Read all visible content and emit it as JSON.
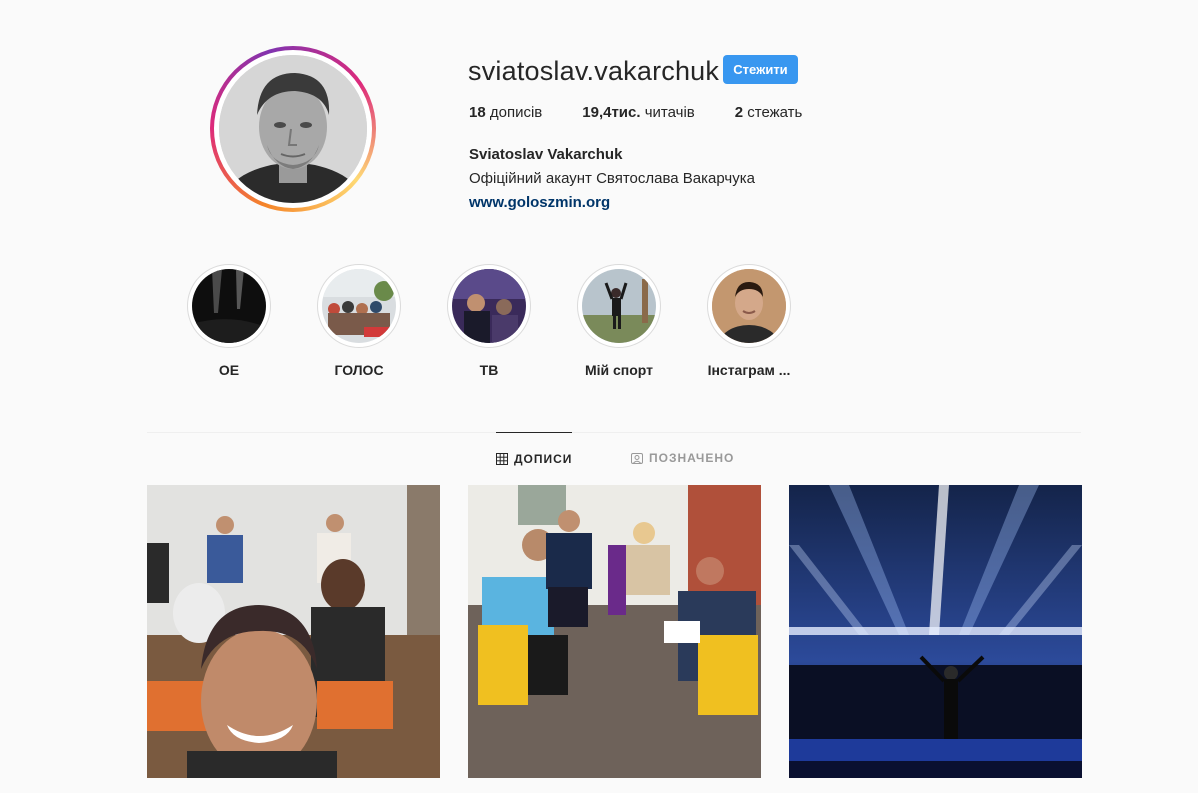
{
  "profile": {
    "username": "sviatoslav.vakarchuk",
    "follow_label": "Стежити",
    "full_name": "Sviatoslav Vakarchuk",
    "bio": "Офіційний акаунт Святослава Вакарчука",
    "website": "www.goloszmin.org"
  },
  "stats": {
    "posts_count": "18",
    "posts_label": " дописів",
    "followers_count": "19,4тис.",
    "followers_label": " читачів",
    "following_count": "2",
    "following_label": " стежать"
  },
  "highlights": [
    {
      "label": "ОЕ"
    },
    {
      "label": "ГОЛОС"
    },
    {
      "label": "ТВ"
    },
    {
      "label": "Мій спорт"
    },
    {
      "label": "Інстаграм ..."
    }
  ],
  "tabs": {
    "posts_label": "ДОПИСИ",
    "tagged_label": "ПОЗНАЧЕНО"
  },
  "colors": {
    "follow_button": "#3897f0",
    "link": "#003569",
    "background": "#fafafa"
  },
  "icons": [
    "grid-icon",
    "tagged-icon"
  ]
}
